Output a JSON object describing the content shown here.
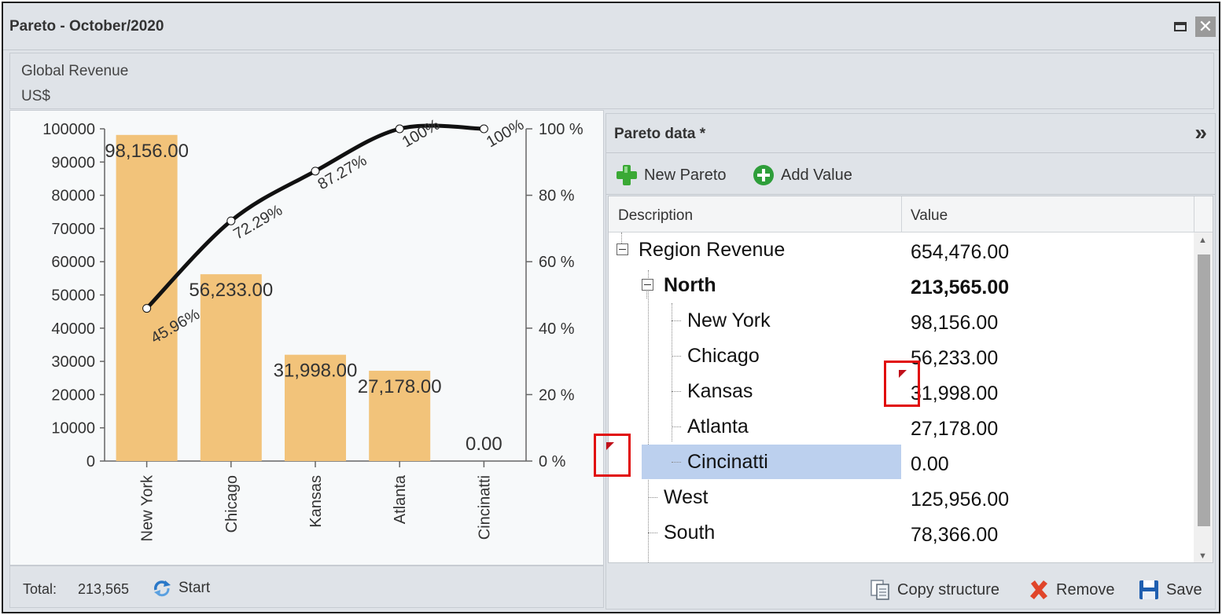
{
  "window": {
    "title": "Pareto - October/2020"
  },
  "header": {
    "title": "Global Revenue",
    "currency": "US$"
  },
  "footer": {
    "total_label": "Total:",
    "total_value": "213,565",
    "start_label": "Start"
  },
  "panel": {
    "title": "Pareto data *",
    "collapse_glyph": "»",
    "toolbar": {
      "new_pareto": "New Pareto",
      "add_value": "Add Value"
    },
    "columns": {
      "description": "Description",
      "value": "Value"
    },
    "rows": [
      {
        "label": "Region Revenue",
        "value": "654,476.00"
      },
      {
        "label": "North",
        "value": "213,565.00"
      },
      {
        "label": "New York",
        "value": "98,156.00"
      },
      {
        "label": "Chicago",
        "value": "56,233.00"
      },
      {
        "label": "Kansas",
        "value": "31,998.00"
      },
      {
        "label": "Atlanta",
        "value": "27,178.00"
      },
      {
        "label": "Cincinatti",
        "value": "0.00"
      },
      {
        "label": "West",
        "value": "125,956.00"
      },
      {
        "label": "South",
        "value": "78,366.00"
      }
    ],
    "footer": {
      "copy_structure": "Copy structure",
      "remove": "Remove",
      "save": "Save"
    }
  },
  "colors": {
    "bar": "#f2c37a",
    "line": "#111111",
    "selection": "#bcd0ee",
    "highlight": "#e10b0b"
  },
  "chart_data": {
    "type": "bar",
    "categories": [
      "New York",
      "Chicago",
      "Kansas",
      "Atlanta",
      "Cincinatti"
    ],
    "values": [
      98156,
      56233,
      31998,
      27178,
      0
    ],
    "data_labels": [
      "98,156.00",
      "56,233.00",
      "31,998.00",
      "27,178.00",
      "0.00"
    ],
    "cumulative_percent": [
      45.96,
      72.29,
      87.27,
      100,
      100
    ],
    "cumulative_labels": [
      "45.96%",
      "72.29%",
      "87.27%",
      "100%",
      "100%"
    ],
    "ylim": [
      0,
      100000
    ],
    "y_ticks": [
      0,
      10000,
      20000,
      30000,
      40000,
      50000,
      60000,
      70000,
      80000,
      90000,
      100000
    ],
    "y2lim": [
      0,
      100
    ],
    "y2_tick_labels": [
      "0 %",
      "20 %",
      "40 %",
      "60 %",
      "80 %",
      "100 %"
    ],
    "grid": false,
    "legend": "none"
  }
}
